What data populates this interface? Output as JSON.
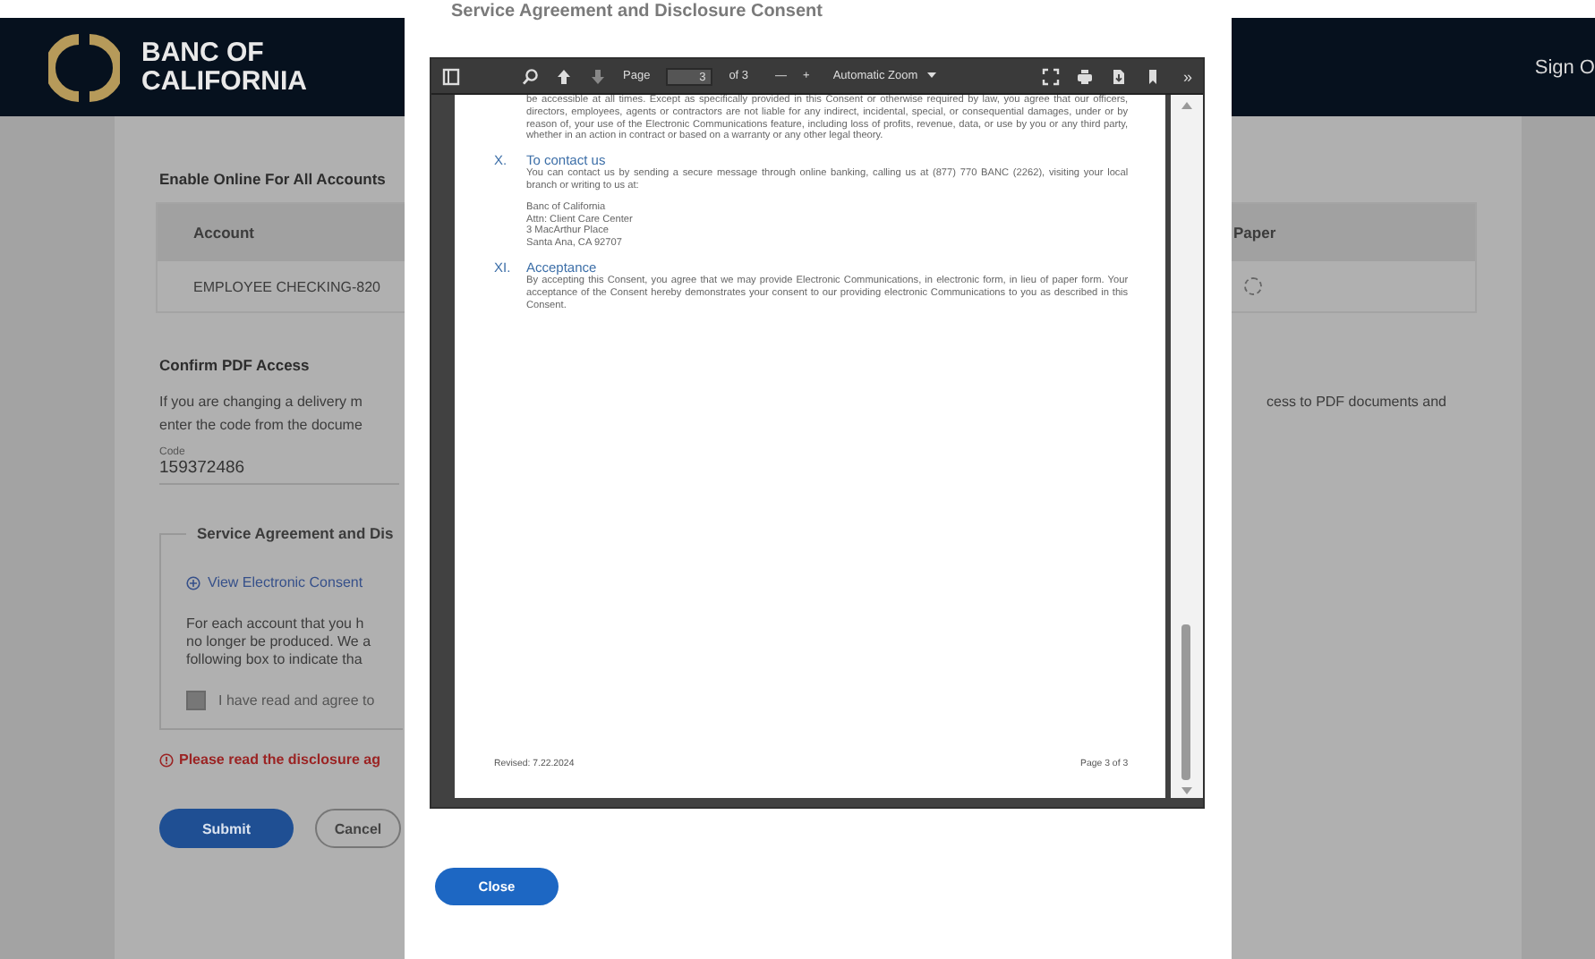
{
  "header": {
    "logo_lines": [
      "BANC OF",
      "CALIFORNIA"
    ],
    "sign_out": "Sign O"
  },
  "form": {
    "section_title": "Enable Online For All Accounts",
    "table": {
      "columns": [
        "Account",
        "Paper"
      ],
      "rows": [
        {
          "account": "EMPLOYEE CHECKING-820",
          "paper_selected": false
        }
      ]
    },
    "confirm": {
      "title": "Confirm PDF Access",
      "text_left": [
        "If you are changing a delivery m",
        "enter the code from the docume"
      ],
      "text_right": "cess to PDF documents and",
      "code_label": "Code",
      "code_value": "159372486"
    },
    "agreement": {
      "legend": "Service Agreement and Dis",
      "link": "View Electronic Consent",
      "text": [
        "For each account that you h",
        "no longer be produced. We a",
        "following box to indicate tha"
      ],
      "checkbox_label": "I have read and agree to",
      "checked": false
    },
    "error": "Please read the disclosure ag",
    "buttons": [
      {
        "label": "Submit",
        "kind": "primary"
      },
      {
        "label": "Cancel",
        "kind": "secondary"
      }
    ]
  },
  "modal": {
    "title": "Service Agreement and Disclosure Consent",
    "toolbar": {
      "page_label": "Page",
      "page_value": "3",
      "page_count": "of 3",
      "zoom_out": "—",
      "zoom_in": "+",
      "zoom": "Automatic Zoom",
      "more": "»"
    },
    "document": {
      "intro": "be accessible at all times. Except as specifically provided in this Consent or otherwise required by law, you agree that our officers, directors, employees, agents or contractors are not liable for any indirect, incidental, special, or consequential damages, under or by reason of, your use of the Electronic Communications feature, including loss of profits, revenue, data, or use by you or any third party, whether in an action in contract or based on a warranty or any other legal theory.",
      "sections": [
        {
          "number": "X.",
          "heading": "To contact us",
          "text": "You can contact us by sending a secure message through online banking, calling us at (877) 770 BANC (2262), visiting your local branch or writing to us at:",
          "address": [
            "Banc of California",
            "Attn: Client Care Center",
            "3 MacArthur Place",
            "Santa Ana, CA 92707"
          ]
        },
        {
          "number": "XI.",
          "heading": "Acceptance",
          "text": "By accepting this Consent, you agree that we may provide Electronic Communications, in electronic form, in lieu of paper form. Your acceptance of the Consent hereby demonstrates your consent to our providing electronic Communications to you as described in this Consent."
        }
      ],
      "footer_left": "Revised: 7.22.2024",
      "footer_right": "Page 3 of 3"
    },
    "close": "Close"
  }
}
